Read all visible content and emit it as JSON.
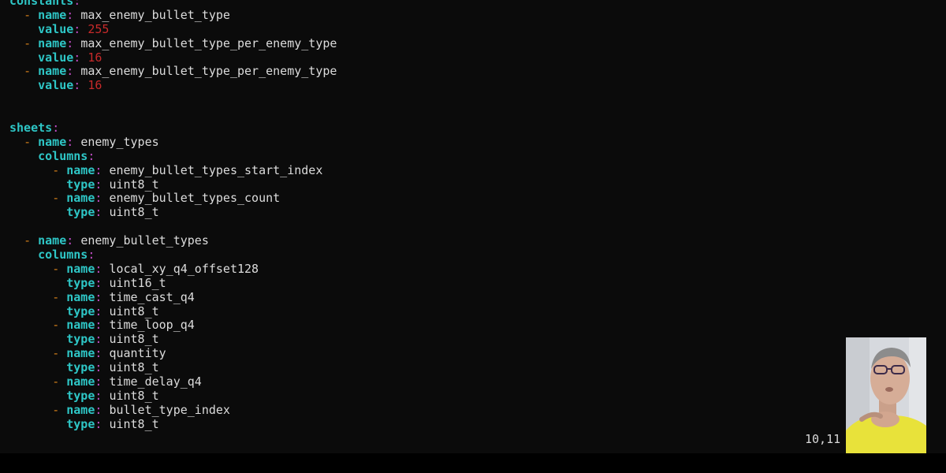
{
  "editor": {
    "lines": [
      {
        "indent": "",
        "dash": false,
        "key": "constants",
        "value": null,
        "value_class": "v"
      },
      {
        "indent": "  ",
        "dash": true,
        "key": "name",
        "value": "max_enemy_bullet_type",
        "value_class": "v"
      },
      {
        "indent": "    ",
        "dash": false,
        "key": "value",
        "value": "255",
        "value_class": "n"
      },
      {
        "indent": "  ",
        "dash": true,
        "key": "name",
        "value": "max_enemy_bullet_type_per_enemy_type",
        "value_class": "v"
      },
      {
        "indent": "    ",
        "dash": false,
        "key": "value",
        "value": "16",
        "value_class": "n"
      },
      {
        "indent": "  ",
        "dash": true,
        "key": "name",
        "value": "max_enemy_bullet_type_per_enemy_type",
        "value_class": "v"
      },
      {
        "indent": "    ",
        "dash": false,
        "key": "value",
        "value": "16",
        "value_class": "n"
      },
      {
        "indent": "",
        "dash": false,
        "key": null,
        "value": null,
        "value_class": "v"
      },
      {
        "indent": "",
        "dash": false,
        "key": null,
        "value": null,
        "value_class": "v"
      },
      {
        "indent": "",
        "dash": false,
        "key": "sheets",
        "value": null,
        "value_class": "v"
      },
      {
        "indent": "  ",
        "dash": true,
        "key": "name",
        "value": "enemy_types",
        "value_class": "v"
      },
      {
        "indent": "    ",
        "dash": false,
        "key": "columns",
        "value": null,
        "value_class": "v"
      },
      {
        "indent": "      ",
        "dash": true,
        "key": "name",
        "value": "enemy_bullet_types_start_index",
        "value_class": "v"
      },
      {
        "indent": "        ",
        "dash": false,
        "key": "type",
        "value": "uint8_t",
        "value_class": "v"
      },
      {
        "indent": "      ",
        "dash": true,
        "key": "name",
        "value": "enemy_bullet_types_count",
        "value_class": "v"
      },
      {
        "indent": "        ",
        "dash": false,
        "key": "type",
        "value": "uint8_t",
        "value_class": "v"
      },
      {
        "indent": "",
        "dash": false,
        "key": null,
        "value": null,
        "value_class": "v"
      },
      {
        "indent": "  ",
        "dash": true,
        "key": "name",
        "value": "enemy_bullet_types",
        "value_class": "v"
      },
      {
        "indent": "    ",
        "dash": false,
        "key": "columns",
        "value": null,
        "value_class": "v"
      },
      {
        "indent": "      ",
        "dash": true,
        "key": "name",
        "value": "local_xy_q4_offset128",
        "value_class": "v"
      },
      {
        "indent": "        ",
        "dash": false,
        "key": "type",
        "value": "uint16_t",
        "value_class": "v"
      },
      {
        "indent": "      ",
        "dash": true,
        "key": "name",
        "value": "time_cast_q4",
        "value_class": "v"
      },
      {
        "indent": "        ",
        "dash": false,
        "key": "type",
        "value": "uint8_t",
        "value_class": "v"
      },
      {
        "indent": "      ",
        "dash": true,
        "key": "name",
        "value": "time_loop_q4",
        "value_class": "v"
      },
      {
        "indent": "        ",
        "dash": false,
        "key": "type",
        "value": "uint8_t",
        "value_class": "v"
      },
      {
        "indent": "      ",
        "dash": true,
        "key": "name",
        "value": "quantity",
        "value_class": "v"
      },
      {
        "indent": "        ",
        "dash": false,
        "key": "type",
        "value": "uint8_t",
        "value_class": "v"
      },
      {
        "indent": "      ",
        "dash": true,
        "key": "name",
        "value": "time_delay_q4",
        "value_class": "v"
      },
      {
        "indent": "        ",
        "dash": false,
        "key": "type",
        "value": "uint8_t",
        "value_class": "v"
      },
      {
        "indent": "      ",
        "dash": true,
        "key": "name",
        "value": "bullet_type_index",
        "value_class": "v"
      },
      {
        "indent": "        ",
        "dash": false,
        "key": "type",
        "value": "uint8_t",
        "value_class": "v"
      }
    ]
  },
  "status": {
    "cursor_position": "10,11"
  },
  "colors": {
    "background": "#0b0b0b",
    "key": "#2ec6c6",
    "colon": "#c34ec7",
    "dash": "#d07d1a",
    "number": "#c72a2a",
    "text": "#dcdcdc"
  }
}
